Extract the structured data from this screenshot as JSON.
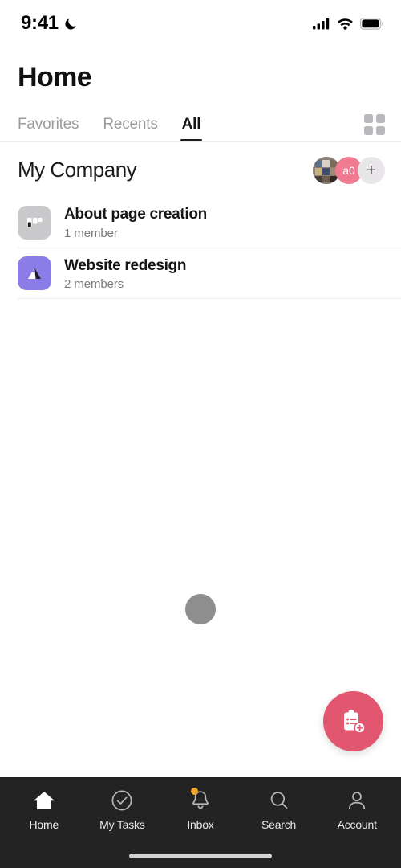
{
  "status_bar": {
    "time": "9:41",
    "dnd_icon": "moon-icon",
    "signal_icon": "cellular-signal-icon",
    "wifi_icon": "wifi-icon",
    "battery_icon": "battery-full-icon"
  },
  "header": {
    "title": "Home",
    "tabs": [
      {
        "label": "Favorites",
        "active": false
      },
      {
        "label": "Recents",
        "active": false
      },
      {
        "label": "All",
        "active": true
      }
    ],
    "grid_toggle_icon": "grid-view-icon"
  },
  "section": {
    "title": "My Company",
    "avatars": [
      {
        "type": "photo",
        "name": "member-photo-avatar",
        "label": ""
      },
      {
        "type": "initials",
        "name": "member-initials-avatar",
        "label": "a0",
        "color": "#f07a8f"
      },
      {
        "type": "add",
        "name": "add-member-button",
        "label": "+",
        "color": "#e8e6e9"
      }
    ]
  },
  "projects": [
    {
      "title": "About page creation",
      "members": "1 member",
      "icon": "board-icon",
      "icon_color": "#c9c8cb"
    },
    {
      "title": "Website redesign",
      "members": "2 members",
      "icon": "mountain-icon",
      "icon_color": "#8b7ce8"
    }
  ],
  "loading_indicator": "loading-dot",
  "fab": {
    "icon": "add-task-icon",
    "color": "#e25670"
  },
  "bottom_nav": {
    "background": "#232323",
    "items": [
      {
        "label": "Home",
        "icon": "home-icon",
        "active": true,
        "badge": false
      },
      {
        "label": "My Tasks",
        "icon": "check-circle-icon",
        "active": false,
        "badge": false
      },
      {
        "label": "Inbox",
        "icon": "bell-icon",
        "active": false,
        "badge": true,
        "badge_color": "#f0a92a"
      },
      {
        "label": "Search",
        "icon": "search-icon",
        "active": false,
        "badge": false
      },
      {
        "label": "Account",
        "icon": "person-icon",
        "active": false,
        "badge": false
      }
    ]
  },
  "home_indicator": "home-indicator-bar"
}
